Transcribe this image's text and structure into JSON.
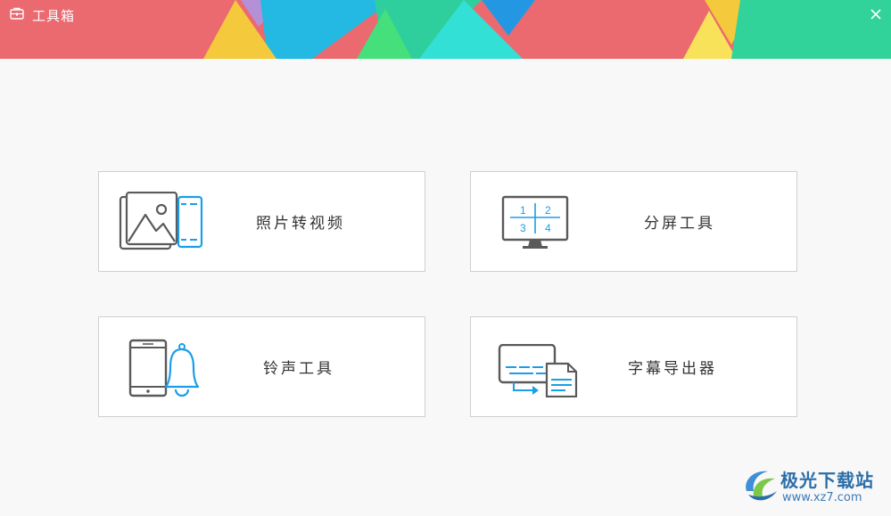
{
  "window": {
    "title": "工具箱",
    "close_symbol": "✕"
  },
  "colors": {
    "title_bar_base": "#ea6a70",
    "blue_accent": "#1a9ee8",
    "icon_gray": "#5a5a5a",
    "watermark_blue": "#2b6ea8"
  },
  "tools": [
    {
      "label": "照片转视频",
      "icon": "photo-to-video-icon"
    },
    {
      "label": "分屏工具",
      "icon": "split-screen-icon",
      "screen_numbers": [
        "1",
        "2",
        "3",
        "4"
      ]
    },
    {
      "label": "铃声工具",
      "icon": "ringtone-icon"
    },
    {
      "label": "字幕导出器",
      "icon": "subtitle-export-icon"
    }
  ],
  "watermark": {
    "brand": "极光下载站",
    "url": "www.xz7.com"
  }
}
